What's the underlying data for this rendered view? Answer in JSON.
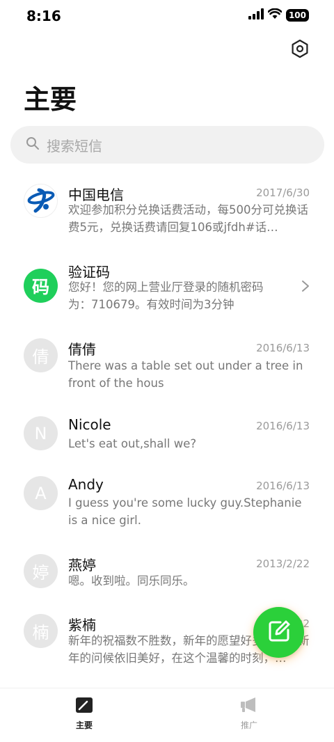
{
  "status_bar": {
    "time": "8:16",
    "battery": "100"
  },
  "header": {
    "title": "主要"
  },
  "search": {
    "placeholder": "搜索短信"
  },
  "messages": [
    {
      "name": "中国电信",
      "date": "2017/6/30",
      "preview": "欢迎参加积分兑换话费活动，每500分可兑换话费5元，兑换话费请回复106或jfdh#话…",
      "avatar": "",
      "avatar_color": "#ffffff"
    },
    {
      "name": "验证码",
      "date": "",
      "preview": "您好！您的网上营业厅登录的随机密码为：710679。有效时间为3分钟",
      "avatar": "码",
      "avatar_color": "#1fcf5b"
    },
    {
      "name": "倩倩",
      "date": "2016/6/13",
      "preview": "There was a table set out under a tree in front of the hous",
      "avatar": "倩",
      "avatar_color": "#e6e6e6"
    },
    {
      "name": "Nicole",
      "date": "2016/6/13",
      "preview": "Let's eat out,shall we?",
      "avatar": "N",
      "avatar_color": "#e6e6e6"
    },
    {
      "name": "Andy",
      "date": "2016/6/13",
      "preview": "I guess you're some lucky guy.Stephanie is a nice girl.",
      "avatar": "A",
      "avatar_color": "#e6e6e6"
    },
    {
      "name": "燕婷",
      "date": "2013/2/22",
      "preview": "嗯。收到啦。同乐同乐。",
      "avatar": "婷",
      "avatar_color": "#e6e6e6"
    },
    {
      "name": "紫楠",
      "date": "2013/2/22",
      "preview": "新年的祝福数不胜数，新年的愿望好多好多，新年的问候依旧美好，在这个温馨的时刻，…",
      "avatar": "楠",
      "avatar_color": "#e6e6e6"
    }
  ],
  "tabs": [
    {
      "label": "主要",
      "active": true
    },
    {
      "label": "推广",
      "active": false
    }
  ],
  "colors": {
    "accent": "#2bd03a",
    "verification_avatar": "#1fcf5b",
    "telecom_blue": "#0a5bb5"
  }
}
